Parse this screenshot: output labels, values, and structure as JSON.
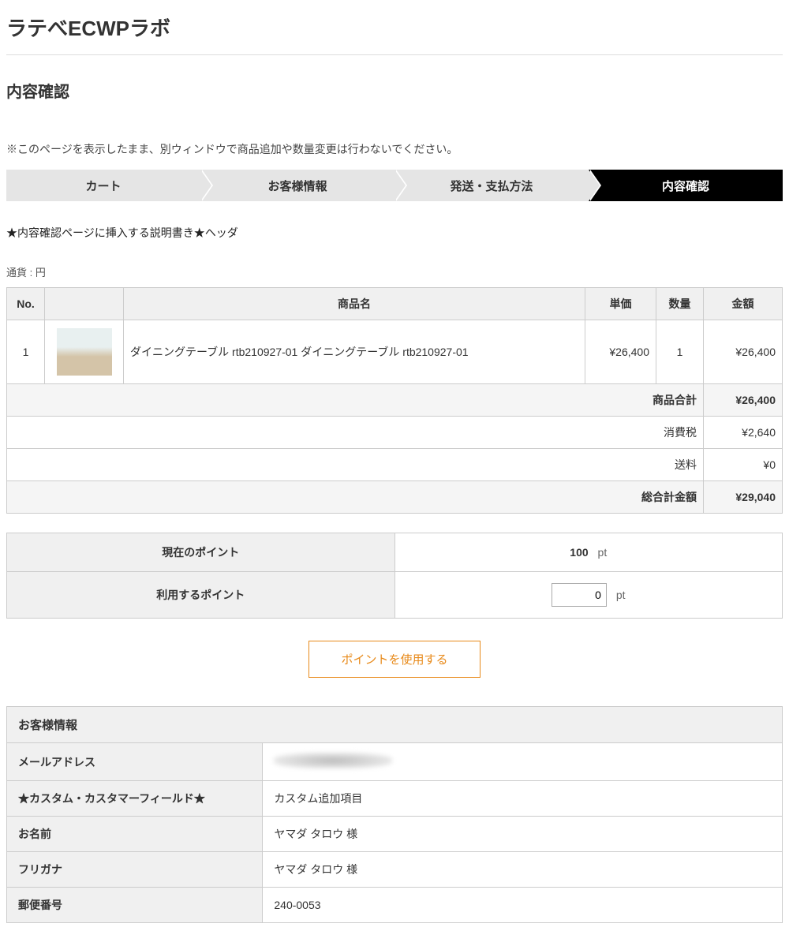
{
  "site_title": "ラテべECWPラボ",
  "page_heading": "内容確認",
  "notice": "※このページを表示したまま、別ウィンドウで商品追加や数量変更は行わないでください。",
  "progress": {
    "steps": [
      "カート",
      "お客様情報",
      "発送・支払方法",
      "内容確認"
    ],
    "active_index": 3
  },
  "header_note": "★内容確認ページに挿入する説明書き★ヘッダ",
  "currency_label": "通貨 : 円",
  "cart": {
    "columns": {
      "no": "No.",
      "name": "商品名",
      "unit_price": "単価",
      "qty": "数量",
      "amount": "金額"
    },
    "items": [
      {
        "no": "1",
        "name": "ダイニングテーブル rtb210927-01 ダイニングテーブル rtb210927-01",
        "unit_price": "¥26,400",
        "qty": "1",
        "amount": "¥26,400"
      }
    ],
    "summary": [
      {
        "label": "商品合計",
        "value": "¥26,400",
        "bold": true
      },
      {
        "label": "消費税",
        "value": "¥2,640",
        "bold": false
      },
      {
        "label": "送料",
        "value": "¥0",
        "bold": false
      },
      {
        "label": "総合計金額",
        "value": "¥29,040",
        "bold": true
      }
    ]
  },
  "points": {
    "current_label": "現在のポイント",
    "current_value": "100",
    "unit": "pt",
    "use_label": "利用するポイント",
    "use_value": "0",
    "button_label": "ポイントを使用する"
  },
  "customer": {
    "section_title": "お客様情報",
    "rows": [
      {
        "label": "メールアドレス",
        "value": "",
        "blurred": true
      },
      {
        "label": "★カスタム・カスタマーフィールド★",
        "value": "カスタム追加項目"
      },
      {
        "label": "お名前",
        "value": "ヤマダ タロウ 様"
      },
      {
        "label": "フリガナ",
        "value": "ヤマダ タロウ 様"
      },
      {
        "label": "郵便番号",
        "value": "240-0053"
      }
    ]
  }
}
